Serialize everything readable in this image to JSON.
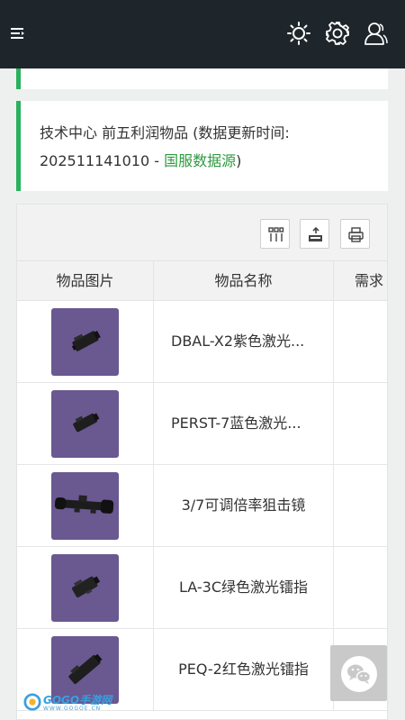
{
  "header": {
    "menu_icon": "menu-icon",
    "icons": [
      "sun-icon",
      "gear-icon",
      "user-icon"
    ]
  },
  "notice": {
    "line1": "技术中心 前五利润物品 (数据更新时间:",
    "timestamp": "202511141010 - ",
    "source_link": "国服数据源",
    "close_paren": ")"
  },
  "toolbar": {
    "buttons": [
      "columns-icon",
      "export-icon",
      "print-icon"
    ]
  },
  "table": {
    "columns": [
      "物品图片",
      "物品名称",
      "需求"
    ],
    "rows": [
      {
        "name": "DBAL-X2紫色激光...",
        "image": "laser-sight-icon"
      },
      {
        "name": "PERST-7蓝色激光...",
        "image": "laser-sight-icon"
      },
      {
        "name": "3/7可调倍率狙击镜",
        "image": "scope-icon"
      },
      {
        "name": "LA-3C绿色激光镭指",
        "image": "laser-sight-icon"
      },
      {
        "name": "PEQ-2红色激光镭指",
        "image": "laser-sight-icon"
      }
    ]
  },
  "floating": {
    "chat_icon": "wechat-icon"
  },
  "watermark": {
    "text": "GOGO手游网",
    "site": "WWW.GOGOE.CN"
  },
  "colors": {
    "accent": "#2ab15c",
    "topbar": "#1f262b",
    "thumb_bg": "#6a5891",
    "link": "#2e9a3e"
  }
}
